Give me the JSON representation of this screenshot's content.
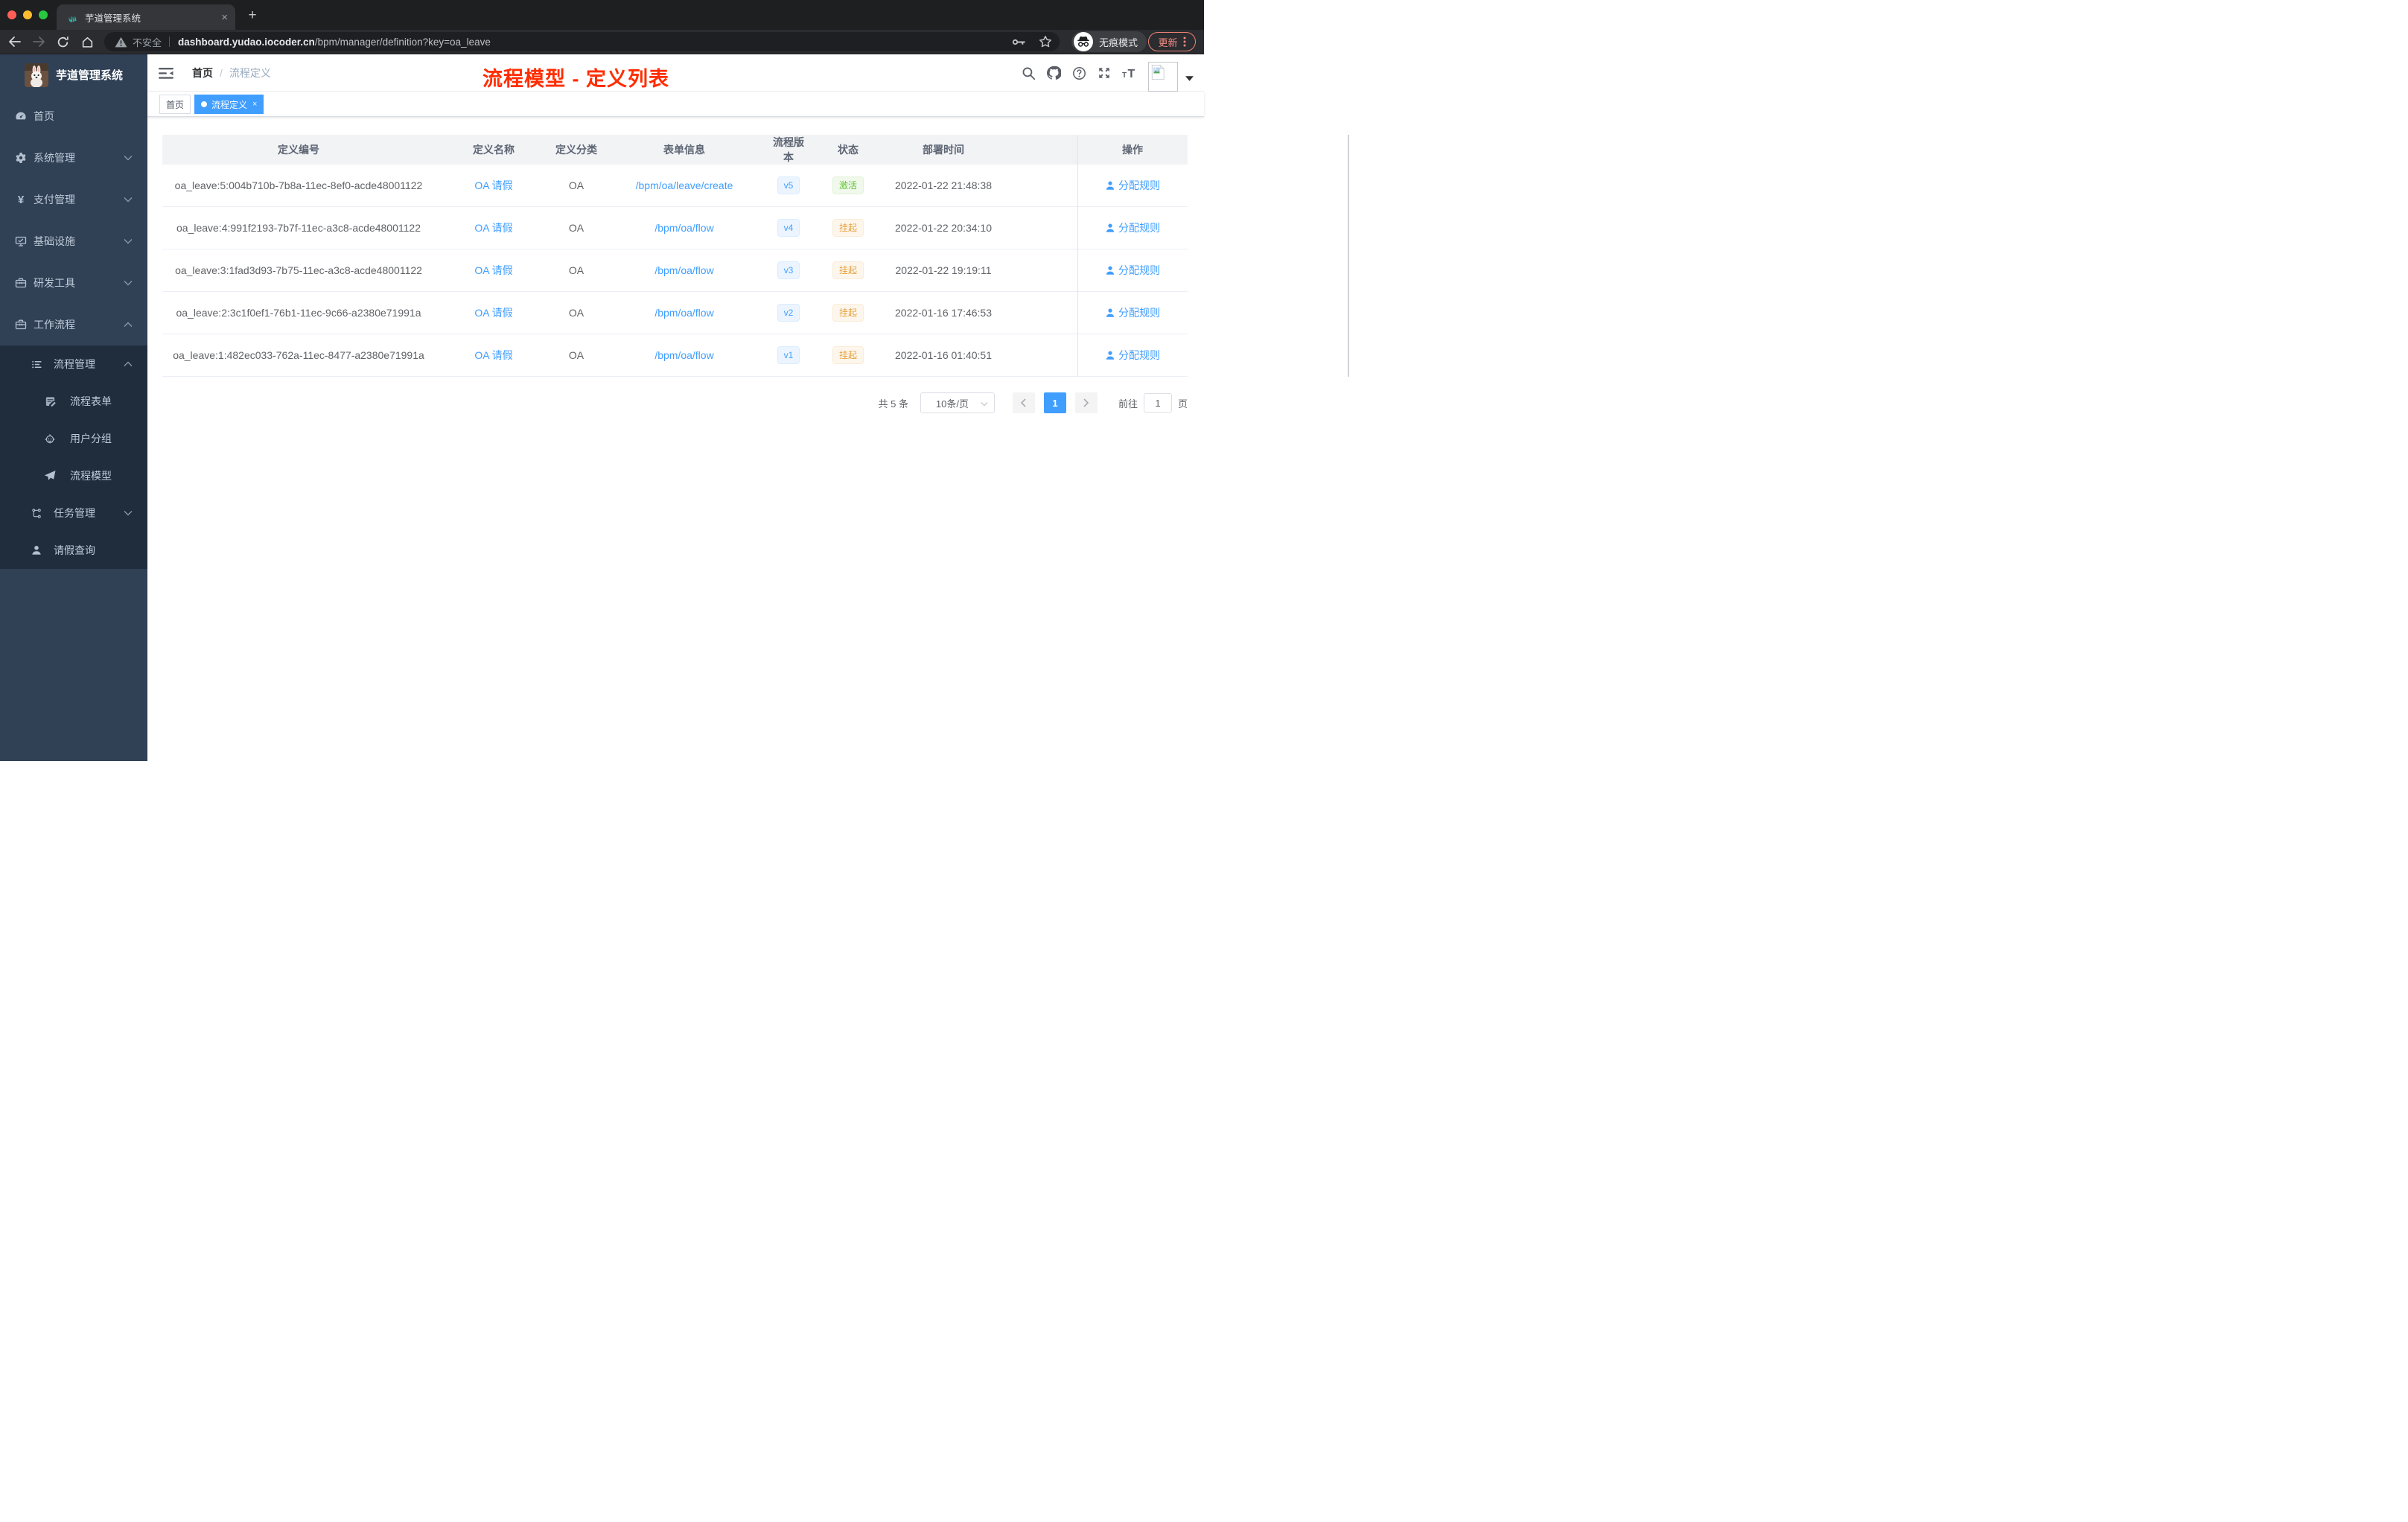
{
  "browser": {
    "tab": {
      "title": "芋道管理系统",
      "close": "×",
      "new_tab": "+"
    },
    "toolbar": {
      "security_label": "不安全",
      "url_host": "dashboard.yudao.iocoder.cn",
      "url_path": "/bpm/manager/definition?key=oa_leave",
      "incognito_label": "无痕模式",
      "update_label": "更新"
    }
  },
  "sidebar": {
    "logo_title": "芋道管理系统",
    "menu": [
      {
        "name": "home",
        "label": "首页",
        "icon": "dashboard-icon",
        "level": 0
      },
      {
        "name": "system",
        "label": "系统管理",
        "icon": "gear-icon",
        "level": 0,
        "chevron": "down"
      },
      {
        "name": "payment",
        "label": "支付管理",
        "icon": "yen-icon",
        "level": 0,
        "chevron": "down"
      },
      {
        "name": "infra",
        "label": "基础设施",
        "icon": "monitor-icon",
        "level": 0,
        "chevron": "down"
      },
      {
        "name": "devtools",
        "label": "研发工具",
        "icon": "toolbox-icon",
        "level": 0,
        "chevron": "down"
      },
      {
        "name": "workflow",
        "label": "工作流程",
        "icon": "toolbox-icon",
        "level": 0,
        "chevron": "up"
      },
      {
        "name": "process-mgmt",
        "label": "流程管理",
        "icon": "tree-list-icon",
        "level": 1,
        "chevron": "up"
      },
      {
        "name": "process-form",
        "label": "流程表单",
        "icon": "form-edit-icon",
        "level": 2
      },
      {
        "name": "user-group",
        "label": "用户分组",
        "icon": "robot-icon",
        "level": 2
      },
      {
        "name": "process-model",
        "label": "流程模型",
        "icon": "paper-plane-icon",
        "level": 2
      },
      {
        "name": "task-mgmt",
        "label": "任务管理",
        "icon": "org-tree-icon",
        "level": 1,
        "chevron": "down"
      },
      {
        "name": "leave-query",
        "label": "请假查询",
        "icon": "user-icon",
        "level": 1
      }
    ]
  },
  "navbar": {
    "breadcrumb_home": "首页",
    "breadcrumb_separator": "/",
    "breadcrumb_current": "流程定义"
  },
  "annotation": {
    "text": "流程模型 - 定义列表",
    "color": "#ff2d00"
  },
  "tags_view": {
    "tags": [
      {
        "label": "首页",
        "active": false
      },
      {
        "label": "流程定义",
        "active": true,
        "close": "×"
      }
    ]
  },
  "table": {
    "columns": [
      "定义编号",
      "定义名称",
      "定义分类",
      "表单信息",
      "流程版本",
      "状态",
      "部署时间",
      "操作"
    ],
    "action_label": "分配规则",
    "rows": [
      {
        "id": "oa_leave:5:004b710b-7b8a-11ec-8ef0-acde48001122",
        "name": "OA 请假",
        "category": "OA",
        "form": "/bpm/oa/leave/create",
        "version": "v5",
        "status": {
          "label": "激活",
          "type": "success"
        },
        "time": "2022-01-22 21:48:38"
      },
      {
        "id": "oa_leave:4:991f2193-7b7f-11ec-a3c8-acde48001122",
        "name": "OA 请假",
        "category": "OA",
        "form": "/bpm/oa/flow",
        "version": "v4",
        "status": {
          "label": "挂起",
          "type": "warning"
        },
        "time": "2022-01-22 20:34:10"
      },
      {
        "id": "oa_leave:3:1fad3d93-7b75-11ec-a3c8-acde48001122",
        "name": "OA 请假",
        "category": "OA",
        "form": "/bpm/oa/flow",
        "version": "v3",
        "status": {
          "label": "挂起",
          "type": "warning"
        },
        "time": "2022-01-22 19:19:11"
      },
      {
        "id": "oa_leave:2:3c1f0ef1-76b1-11ec-9c66-a2380e71991a",
        "name": "OA 请假",
        "category": "OA",
        "form": "/bpm/oa/flow",
        "version": "v2",
        "status": {
          "label": "挂起",
          "type": "warning"
        },
        "time": "2022-01-16 17:46:53"
      },
      {
        "id": "oa_leave:1:482ec033-762a-11ec-8477-a2380e71991a",
        "name": "OA 请假",
        "category": "OA",
        "form": "/bpm/oa/flow",
        "version": "v1",
        "status": {
          "label": "挂起",
          "type": "warning"
        },
        "time": "2022-01-16 01:40:51"
      }
    ]
  },
  "pagination": {
    "total": "共 5 条",
    "page_size": "10条/页",
    "page": "1",
    "goto": "前往",
    "goto_value": "1",
    "unit": "页"
  },
  "colors": {
    "accent": "#409eff",
    "success": "#67c23a",
    "warning": "#e6a23c",
    "sidebar": "#304156",
    "sidebar_submenu": "#1f2d3d",
    "annotation_red": "#ff2d00",
    "update_coral": "#f28b82"
  }
}
